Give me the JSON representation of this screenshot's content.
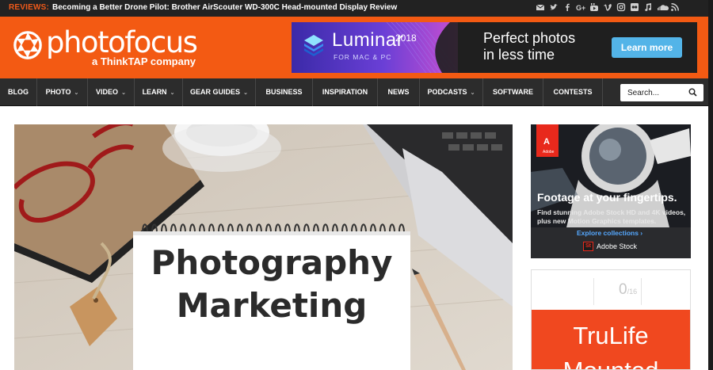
{
  "topbar": {
    "reviews_label": "REVIEWS:",
    "review_title": "Becoming a Better Drone Pilot: Brother AirScouter WD-300C Head-mounted Display Review",
    "social_icons": [
      "email-icon",
      "twitter-icon",
      "facebook-icon",
      "google-plus-icon",
      "youtube-icon",
      "vimeo-icon",
      "instagram-icon",
      "flickr-icon",
      "itunes-icon",
      "soundcloud-icon",
      "rss-icon"
    ]
  },
  "header": {
    "logo_name": "photofocus",
    "logo_tagline": "a ThinkTAP company",
    "banner": {
      "product": "Luminar",
      "year": "2018",
      "platform": "FOR MAC & PC",
      "headline_line1": "Perfect photos",
      "headline_line2": "in less time",
      "cta": "Learn more"
    }
  },
  "nav": {
    "items": [
      {
        "label": "BLOG",
        "caret": ""
      },
      {
        "label": "PHOTO",
        "caret": "⌄"
      },
      {
        "label": "VIDEO",
        "caret": "⌄"
      },
      {
        "label": "LEARN",
        "caret": "⌄"
      },
      {
        "label": "GEAR GUIDES",
        "caret": "⌄"
      },
      {
        "label": "BUSINESS",
        "caret": ""
      },
      {
        "label": "INSPIRATION",
        "caret": ""
      },
      {
        "label": "NEWS",
        "caret": ""
      },
      {
        "label": "PODCASTS",
        "caret": "⌄"
      },
      {
        "label": "SOFTWARE",
        "caret": ""
      },
      {
        "label": "CONTESTS",
        "caret": ""
      }
    ],
    "search_placeholder": "Search..."
  },
  "hero": {
    "notepad_line1": "Photography",
    "notepad_line2": "Marketing"
  },
  "sidebar": {
    "adobe_ad": {
      "brand_mark": "A",
      "brand_label": "Adobe",
      "headline": "Footage at your fingertips.",
      "body": "Find stunning Adobe Stock HD and 4K videos, plus new Motion Graphics templates.",
      "link": "Explore collections ›",
      "product_badge": "St",
      "product": "Adobe Stock"
    },
    "trulife_ad": {
      "counter_value": "0",
      "counter_total": "/16",
      "title_line1": "TruLife",
      "title_line2": "Mounted"
    }
  },
  "colors": {
    "brand_orange": "#f35a13",
    "nav_bg": "#2c2c2c",
    "topbar_bg": "#222222",
    "cta_blue": "#53b4e8"
  }
}
